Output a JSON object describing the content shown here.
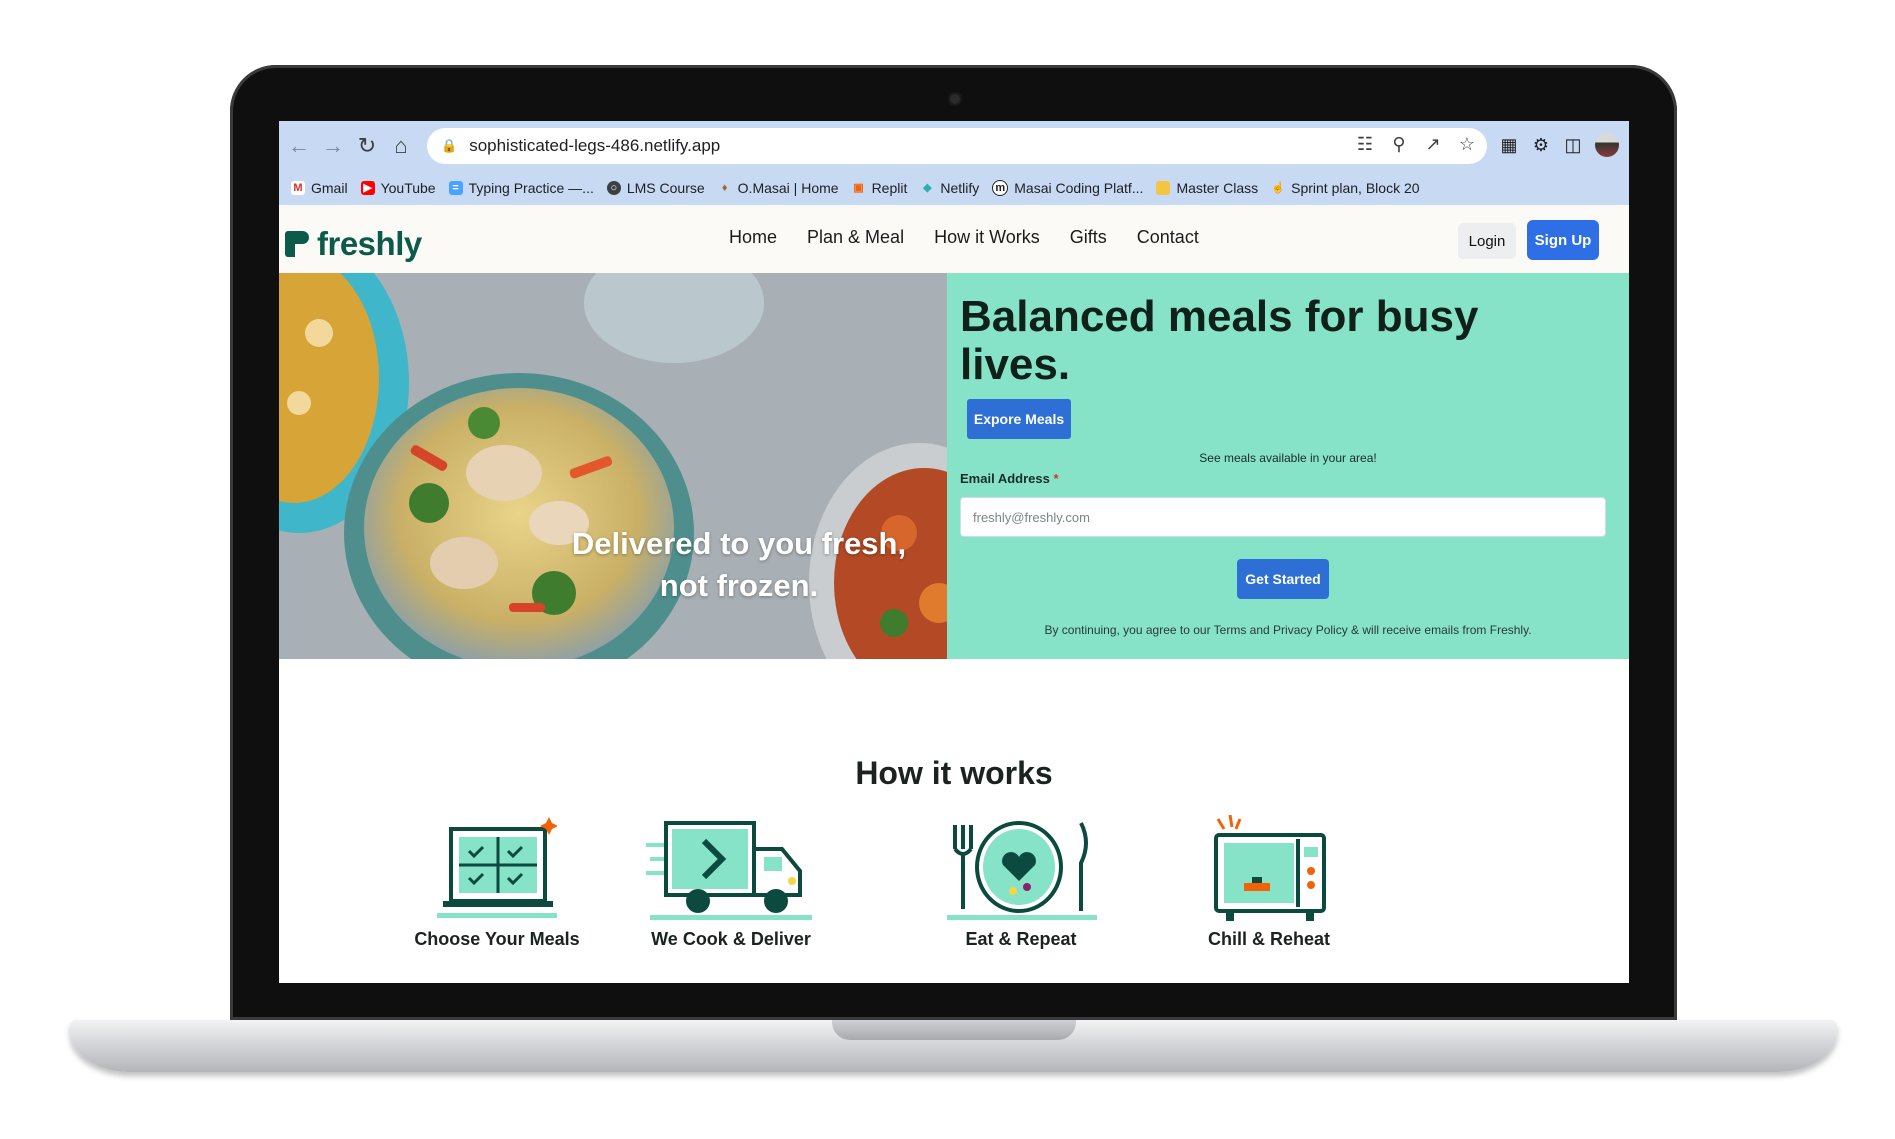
{
  "browser": {
    "url": "sophisticated-legs-486.netlify.app",
    "bookmarks": [
      {
        "label": "Gmail",
        "icon": "gmail-icon",
        "color": "#d93025"
      },
      {
        "label": "YouTube",
        "icon": "youtube-icon",
        "color": "#ff0000"
      },
      {
        "label": "Typing Practice —...",
        "icon": "typing-icon",
        "color": "#4aa3ff"
      },
      {
        "label": "LMS Course",
        "icon": "globe-icon",
        "color": "#3c4043"
      },
      {
        "label": "O.Masai | Home",
        "icon": "pin-icon",
        "color": "#9b6c2e"
      },
      {
        "label": "Replit",
        "icon": "replit-icon",
        "color": "#f26207"
      },
      {
        "label": "Netlify",
        "icon": "netlify-icon",
        "color": "#2bb0ad"
      },
      {
        "label": "Masai Coding Platf...",
        "icon": "masai-icon",
        "color": "#222222"
      },
      {
        "label": "Master Class",
        "icon": "folder-icon",
        "color": "#f4c542"
      },
      {
        "label": "Sprint plan, Block 20",
        "icon": "hand-icon",
        "color": "#3b82f6"
      }
    ]
  },
  "site": {
    "logo": "freshly",
    "nav": [
      "Home",
      "Plan & Meal",
      "How it Works",
      "Gifts",
      "Contact"
    ],
    "login": "Login",
    "signup": "Sign Up",
    "brand_color": "#0c5a4a",
    "accent_color": "#86e3c7"
  },
  "hero": {
    "title": "Balanced meals for busy lives.",
    "explore": "Expore Meals",
    "see_meals": "See meals available in your area!",
    "email_label": "Email Address",
    "email_required": "*",
    "email_placeholder": "freshly@freshly.com",
    "get_started": "Get Started",
    "disclaimer": "By continuing, you agree to our Terms and Privacy Policy & will receive emails from Freshly.",
    "tagline_line1": "Delivered to you fresh,",
    "tagline_line2": "not frozen."
  },
  "how": {
    "title": "How it works",
    "steps": [
      {
        "label": "Choose Your Meals",
        "icon": "calendar-check-icon"
      },
      {
        "label": "We Cook & Deliver",
        "icon": "delivery-truck-icon"
      },
      {
        "label": "Eat & Repeat",
        "icon": "plate-heart-icon"
      },
      {
        "label": "Chill & Reheat",
        "icon": "microwave-icon"
      }
    ]
  }
}
